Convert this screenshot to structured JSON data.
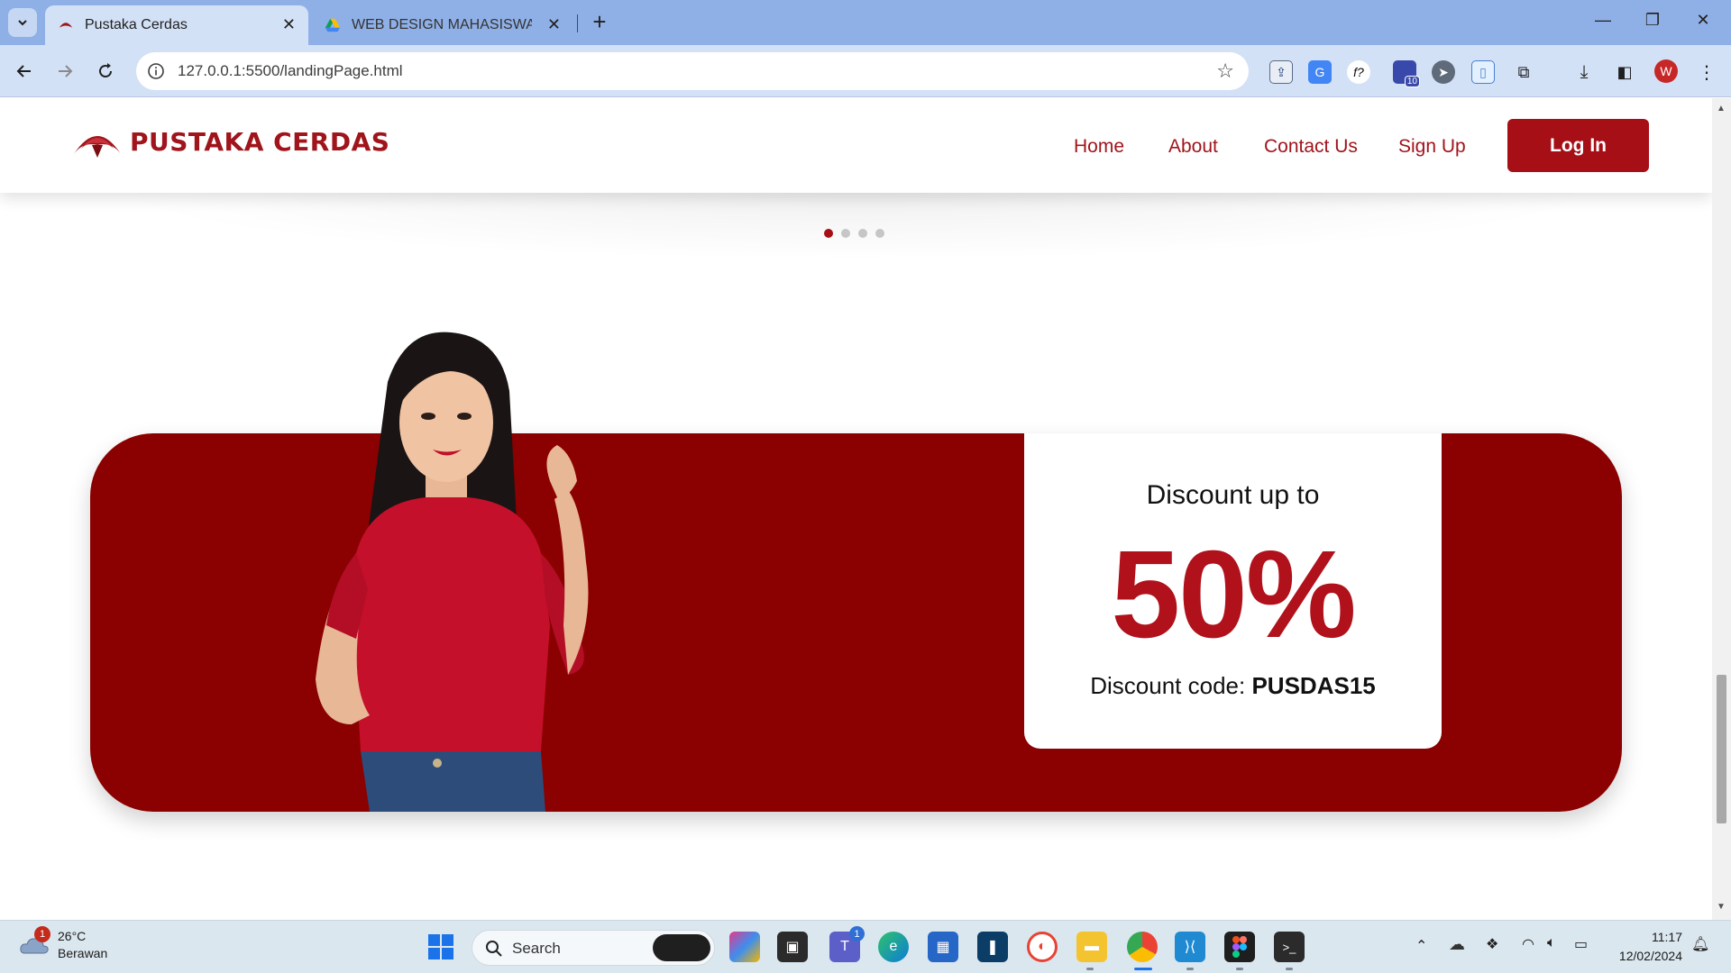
{
  "browser": {
    "tabs": [
      {
        "title": "Pustaka Cerdas",
        "active": true
      },
      {
        "title": "WEB DESIGN MAHASISWA - Go",
        "active": false
      }
    ],
    "address": "127.0.0.1:5500/landingPage.html",
    "profile_initial": "W",
    "extension_badge": "10"
  },
  "site": {
    "brand": "PUSTAKA CERDAS",
    "nav": {
      "home": "Home",
      "about": "About",
      "contact": "Contact Us",
      "signup": "Sign Up",
      "login": "Log In"
    },
    "carousel": {
      "slide_count": 4,
      "active_index": 0
    },
    "promo": {
      "lead": "Discount up to",
      "amount": "50%",
      "code_label": "Discount code:",
      "code": "PUSDAS15"
    },
    "colors": {
      "brand": "#a0141b",
      "banner": "#8b0000",
      "button": "#a70f17"
    }
  },
  "taskbar": {
    "weather_temp": "26°C",
    "weather_cond": "Berawan",
    "weather_badge": "1",
    "search_label": "Search",
    "teams_badge": "1",
    "time": "11:17",
    "date": "12/02/2024"
  }
}
